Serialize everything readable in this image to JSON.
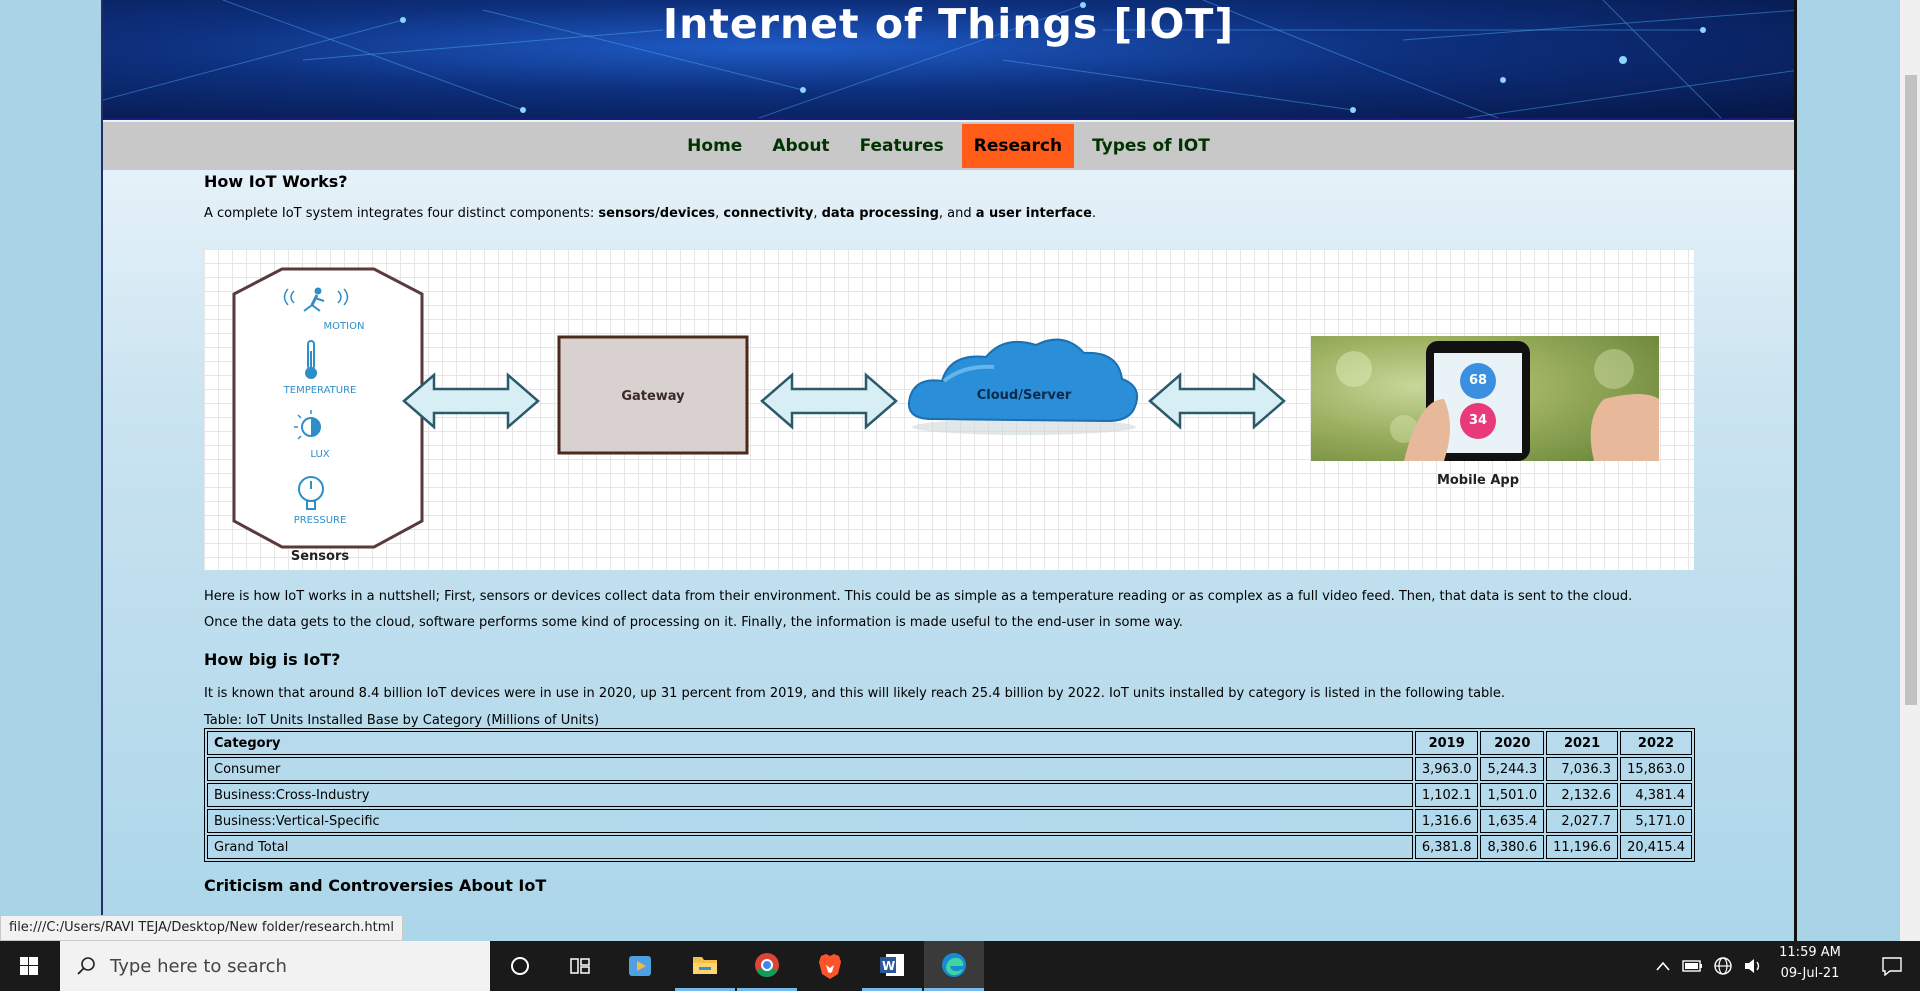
{
  "banner": {
    "title": "Internet of Things [IOT]"
  },
  "nav": {
    "items": [
      {
        "label": "Home"
      },
      {
        "label": "About"
      },
      {
        "label": "Features"
      },
      {
        "label": "Research",
        "active": true
      },
      {
        "label": "Types of IOT"
      }
    ],
    "active_color": "#ff5c1a"
  },
  "section1": {
    "heading": "How IoT Works?",
    "intro_prefix": "A complete IoT system integrates four distinct components: ",
    "intro_b1": "sensors/devices",
    "intro_sep1": ", ",
    "intro_b2": "connectivity",
    "intro_sep2": ", ",
    "intro_b3": "data processing",
    "intro_sep3": ", and ",
    "intro_b4": "a user interface",
    "intro_end": "."
  },
  "diagram": {
    "sensor_labels": [
      "MOTION",
      "TEMPERATURE",
      "LUX",
      "PRESSURE"
    ],
    "sensors_caption": "Sensors",
    "gateway_label": "Gateway",
    "cloud_label": "Cloud/Server",
    "app_caption": "Mobile App",
    "phone_values": [
      "68",
      "34"
    ]
  },
  "section1_body": {
    "line1": "Here is how IoT works in a nuttshell; First, sensors or devices collect data from their environment. This could be as simple as a temperature reading or as complex as a full video feed. Then, that data is sent to the cloud.",
    "line2": "Once the data gets to the cloud, software performs some kind of processing on it. Finally, the information is made useful to the end-user in some way."
  },
  "section2": {
    "heading": "How big is IoT?",
    "body": "It is known that around 8.4 billion IoT devices were in use in 2020, up 31 percent from 2019, and this will likely reach 25.4 billion by 2022. IoT units installed by category is listed in the following table.",
    "caption": "Table: IoT Units Installed Base by Category (Millions of Units)"
  },
  "table": {
    "headers": [
      "Category",
      "2019",
      "2020",
      "2021",
      "2022"
    ],
    "rows": [
      [
        "Consumer",
        "3,963.0",
        "5,244.3",
        "7,036.3",
        "15,863.0"
      ],
      [
        "Business:Cross-Industry",
        "1,102.1",
        "1,501.0",
        "2,132.6",
        "4,381.4"
      ],
      [
        "Business:Vertical-Specific",
        "1,316.6",
        "1,635.4",
        "2,027.7",
        "5,171.0"
      ],
      [
        "Grand Total",
        "6,381.8",
        "8,380.6",
        "11,196.6",
        "20,415.4"
      ]
    ]
  },
  "section3": {
    "heading": "Criticism and Controversies About IoT"
  },
  "status_url": "file:///C:/Users/RAVI TEJA/Desktop/New folder/research.html",
  "taskbar": {
    "search_placeholder": "Type here to search",
    "time": "11:59 AM",
    "date": "09-Jul-21",
    "icons": [
      "windows-start-icon",
      "cortana-icon",
      "task-view-icon",
      "media-player-icon",
      "file-explorer-icon",
      "chrome-icon",
      "brave-icon",
      "word-icon",
      "edge-icon"
    ]
  }
}
